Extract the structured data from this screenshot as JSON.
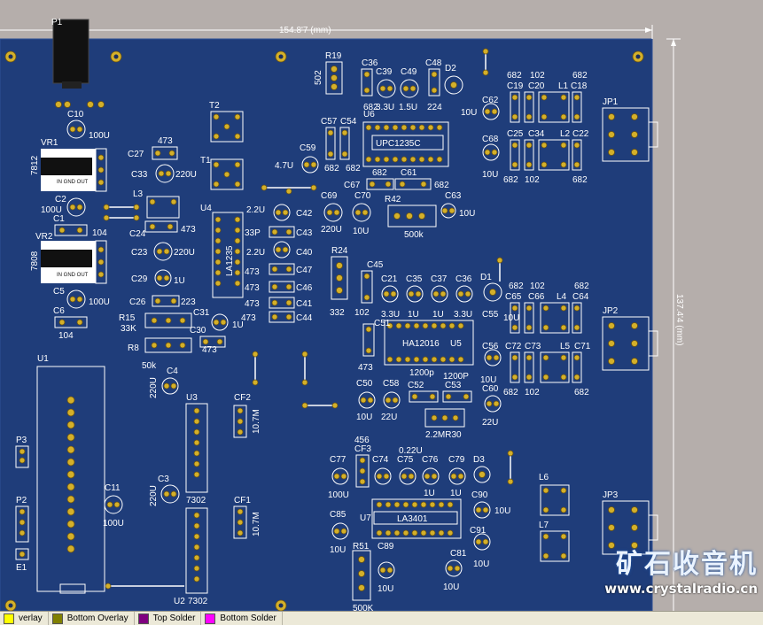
{
  "dimensions": {
    "width_label": "154.8'7 (mm)",
    "height_label": "137.4'4 (mm)"
  },
  "components": {
    "P1": "P1",
    "R19": "R19",
    "C36": "C36",
    "C39": "C39",
    "C49": "C49",
    "C48": "C48",
    "D2": "D2",
    "v502": "502",
    "v682a": "682",
    "v33u": "3.3U",
    "v15u": "1.5U",
    "v224": "224",
    "C10": "C10",
    "v100u_a": "100U",
    "VR1": "VR1",
    "v7812": "7812",
    "in_gnd_out_1": "IN GND OUT",
    "T2": "T2",
    "T1": "T1",
    "C27": "C27",
    "v473a": "473",
    "C33": "C33",
    "v220u_a": "220U",
    "C57": "C57",
    "C54": "C54",
    "U6": "U6",
    "UPC1235C": "UPC1235C",
    "C59": "C59",
    "v47u": "4.7U",
    "v682b": "682",
    "v682c": "682",
    "v682d": "682",
    "C61": "C61",
    "C67": "C67",
    "v682e": "682",
    "C62": "C62",
    "v10u_a": "10U",
    "v682f": "682",
    "v102a": "102",
    "C19": "C19",
    "C20": "C20",
    "L1": "L1",
    "C18": "C18",
    "v682g": "682",
    "C68": "C68",
    "C25": "C25",
    "C34": "C34",
    "L2": "L2",
    "C22": "C22",
    "v10u_b": "10U",
    "v682h": "682",
    "v102b": "102",
    "v682i": "682",
    "JP1": "JP1",
    "JP2": "JP2",
    "JP3": "JP3",
    "C2": "C2",
    "v100u_b": "100U",
    "C1": "C1",
    "v104a": "104",
    "L3": "L3",
    "C24": "C24",
    "v473b": "473",
    "U4": "U4",
    "LA1235": "LA1235",
    "v22u_a": "2.2U",
    "C42": "C42",
    "v33p": "33P",
    "C43": "C43",
    "v22u_b": "2.2U",
    "C40": "C40",
    "v473c": "473",
    "C47": "C47",
    "v473d": "473",
    "C46": "C46",
    "v473e": "473",
    "C41": "C41",
    "v473f": "473",
    "C44": "C44",
    "C69": "C69",
    "v220u_b": "220U",
    "C70": "C70",
    "v10u_c": "10U",
    "R42": "R42",
    "v500k_a": "500k",
    "C63": "C63",
    "v10u_d": "10U",
    "VR2": "VR2",
    "v7808": "7808",
    "in_gnd_out_2": "IN GND OUT",
    "C23": "C23",
    "v220u_c": "220U",
    "C29": "C29",
    "v1u_a": "1U",
    "C5": "C5",
    "v100u_c": "100U",
    "C6": "C6",
    "v104b": "104",
    "C26": "C26",
    "v223": "223",
    "R15": "R15",
    "v33k": "33K",
    "C31": "C31",
    "v1u_b": "1U",
    "C30": "C30",
    "v473g": "473",
    "R8": "R8",
    "v50k": "50k",
    "R24": "R24",
    "v332": "332",
    "C45": "C45",
    "v102c": "102",
    "C21": "C21",
    "C35": "C35",
    "C37": "C37",
    "C36b": "C36",
    "D1": "D1",
    "v33u_b": "3.3U",
    "v1u_c": "1U",
    "v1u_d": "1U",
    "v33u_c": "3.3U",
    "C55": "C55",
    "v682j": "682",
    "v102d": "102",
    "C65": "C65",
    "C66": "C66",
    "L4": "L4",
    "v682k": "682",
    "C64": "C64",
    "v10u_e": "10U",
    "C51": "C51",
    "HA12016": "HA12016",
    "U5": "U5",
    "v473h": "473",
    "v1200p_a": "1200p",
    "v1200p_b": "1200P",
    "C56": "C56",
    "v10u_f": "10U",
    "C72": "C72",
    "C73": "C73",
    "L5": "L5",
    "C71": "C71",
    "v682l": "682",
    "v102e": "102",
    "v682m": "682",
    "U1": "U1",
    "C4": "C4",
    "v220u_d": "220U",
    "U3": "U3",
    "CF2": "CF2",
    "v107m_a": "10.7M",
    "C50": "C50",
    "C58": "C58",
    "C52": "C52",
    "C53": "C53",
    "C60": "C60",
    "v10u_g": "10U",
    "v22u_c": "22U",
    "v22u_d": "22U",
    "v22mr30": "2.2MR30",
    "P3": "P3",
    "P2": "P2",
    "E1": "E1",
    "C11": "C11",
    "v100u_d": "100U",
    "C3": "C3",
    "v220u_e": "220U",
    "v7302a": "7302",
    "CF1": "CF1",
    "v107m_b": "10.7M",
    "U2": "U2",
    "v7302b": "7302",
    "v456": "456",
    "CF3": "CF3",
    "v022u": "0.22U",
    "C77": "C77",
    "C74": "C74",
    "C75": "C75",
    "C76": "C76",
    "C79": "C79",
    "D3": "D3",
    "v100u_e": "100U",
    "v1u_e": "1U",
    "v1u_f": "1U",
    "C90": "C90",
    "v10u_h": "10U",
    "L6": "L6",
    "L7": "L7",
    "C85": "C85",
    "v10u_i": "10U",
    "U7": "U7",
    "LA3401": "LA3401",
    "C91": "C91",
    "v10u_j": "10U",
    "R51": "R51",
    "C89": "C89",
    "v10u_k": "10U",
    "C81": "C81",
    "v10u_l": "10U",
    "v500k_b": "500K"
  },
  "layer_tabs": [
    {
      "label": "verlay",
      "color": "#ffff00"
    },
    {
      "label": "Bottom Overlay",
      "color": "#808000"
    },
    {
      "label": "Top Solder",
      "color": "#800080"
    },
    {
      "label": "Bottom Solder",
      "color": "#ff00ff"
    }
  ],
  "watermark": {
    "brand": "矿石收音机",
    "url": "www.crystalradio.cn"
  },
  "colors": {
    "board": "#1f3d7a",
    "pad": "#d4b02a",
    "silk": "#ffffff",
    "workspace": "#b5aeab"
  }
}
